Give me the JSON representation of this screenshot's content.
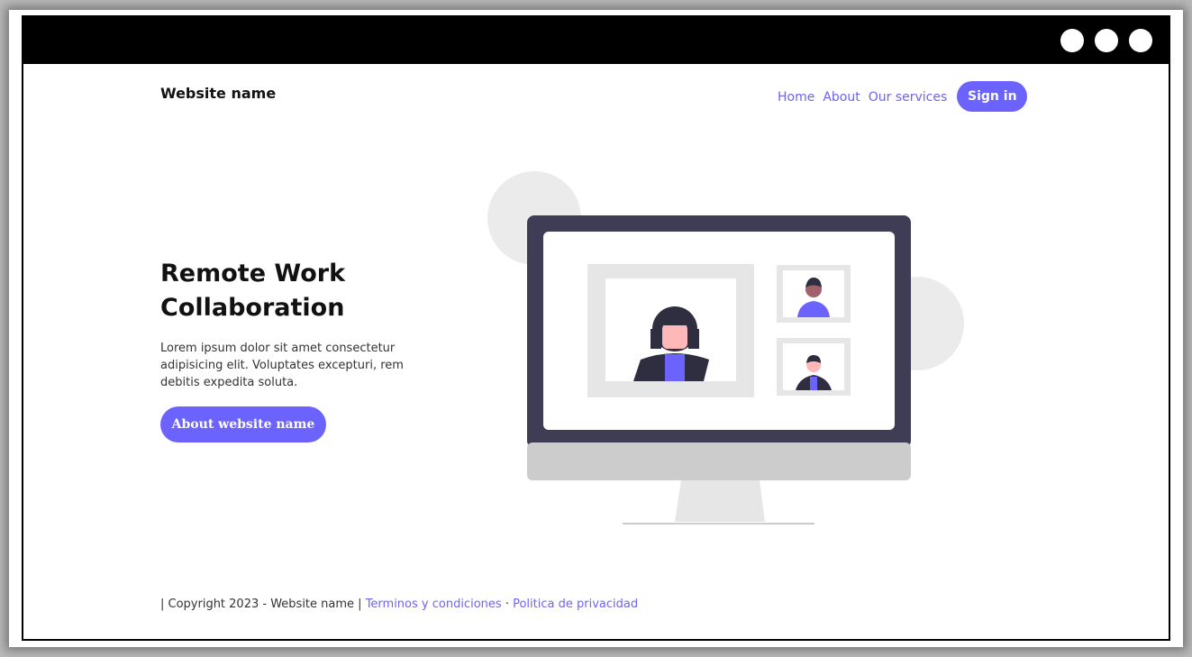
{
  "header": {
    "brand": "Website name",
    "nav": {
      "home": "Home",
      "about": "About",
      "services": "Our services"
    },
    "signin_label": "Sign in"
  },
  "hero": {
    "title": "Remote Work Collaboration",
    "description": "Lorem ipsum dolor sit amet consectetur adipisicing elit. Voluptates excepturi, rem debitis expedita soluta.",
    "cta_label": "About website name"
  },
  "footer": {
    "copyright": "| Copyright 2023 - Website name |",
    "terms_link": "Terminos y condiciones",
    "separator": "·",
    "privacy_link": "Politica de privacidad"
  },
  "colors": {
    "accent": "#6c63ff",
    "titlebar": "#000000",
    "monitor_dark": "#3f3d56",
    "light_gray": "#e6e6e6"
  },
  "icons": {
    "window_controls": [
      "window-dot-icon",
      "window-dot-icon",
      "window-dot-icon"
    ],
    "illustration": "video-conference-monitor-illustration"
  }
}
